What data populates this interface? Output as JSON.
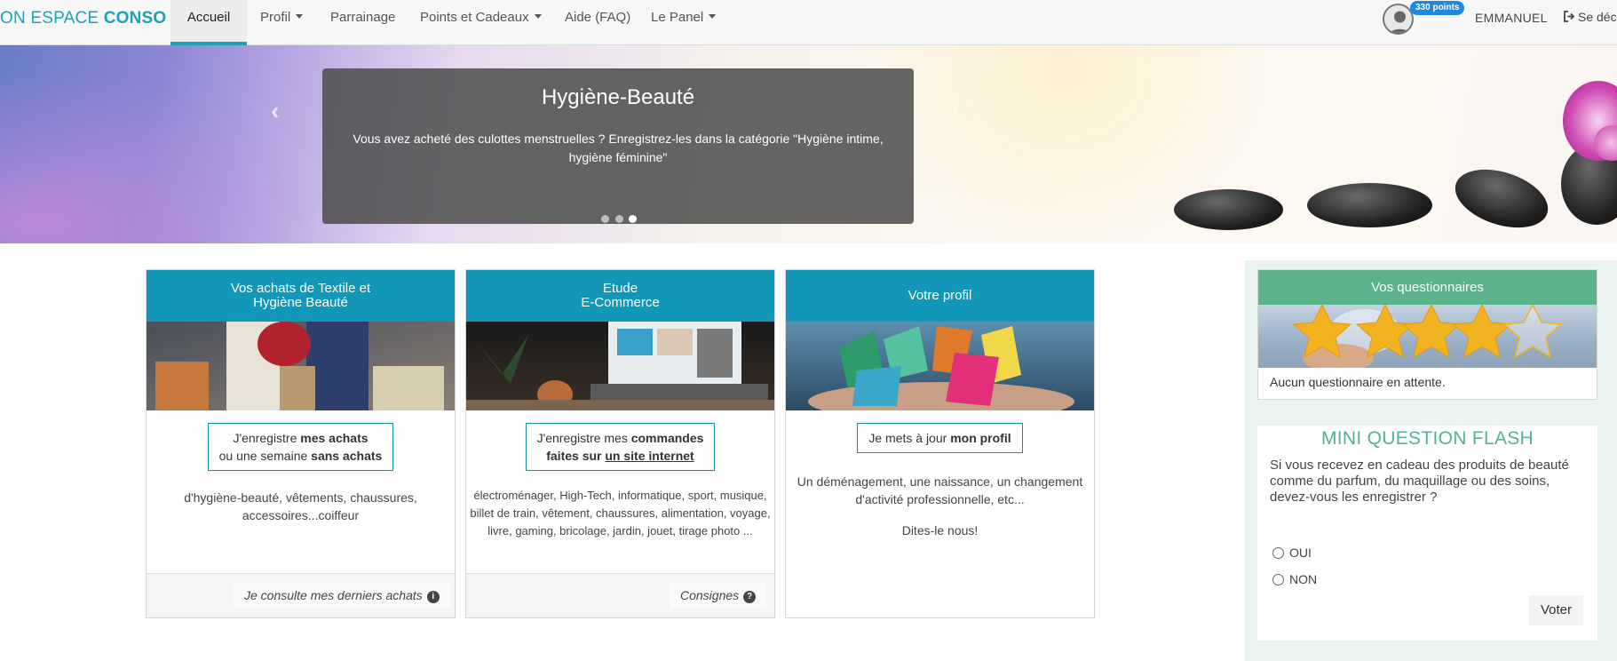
{
  "navbar": {
    "brand_prefix": "ON ESPACE ",
    "brand_bold": "CONSO",
    "items": [
      {
        "label": "Accueil"
      },
      {
        "label": "Profil"
      },
      {
        "label": "Parrainage"
      },
      {
        "label": "Points et Cadeaux"
      },
      {
        "label": "Aide (FAQ)"
      },
      {
        "label": "Le Panel"
      }
    ],
    "points_badge": "330 points",
    "username": "EMMANUEL",
    "logout_label": "Se déc",
    "icons": {
      "avatar": "user-avatar-icon",
      "logout": "sign-out-icon"
    }
  },
  "hero": {
    "title": "Hygiène-Beauté",
    "text": "Vous avez acheté des culottes menstruelles ? Enregistrez-les dans la catégorie \"Hygiène intime, hygiène féminine\"",
    "slide_count": 3,
    "active_slide": 3,
    "icons": {
      "prev": "chevron-left-icon",
      "next": "chevron-right-icon"
    }
  },
  "cards": [
    {
      "title_line1": "Vos achats de Textile et",
      "title_line2": "Hygiène Beauté",
      "cta_line1_pre": "J'enregistre ",
      "cta_line1_bold": "mes achats",
      "cta_line2_pre": "ou une semaine ",
      "cta_line2_bold": "sans achats",
      "desc": "d'hygiène-beauté, vêtements, chaussures, accessoires...coiffeur",
      "footer_link": "Je consulte mes derniers achats",
      "footer_icon": "info-circle-icon"
    },
    {
      "title_line1": "Etude",
      "title_line2": "E-Commerce",
      "cta_line1_pre": "J'enregistre mes ",
      "cta_line1_bold": "commandes",
      "cta_line2_pre": "faites sur ",
      "cta_line2_bold": "un site internet",
      "desc": "électroménager, High-Tech, informatique, sport, musique, billet de train, vêtement, chaussures, alimentation, voyage, livre, gaming, bricolage, jardin, jouet, tirage photo ...",
      "footer_link": "Consignes",
      "footer_icon": "question-circle-icon"
    },
    {
      "title": "Votre profil",
      "cta_pre": "Je mets à jour ",
      "cta_bold": "mon profil",
      "desc": "Un déménagement, une naissance, un changement d'activité professionnelle, etc...",
      "desc2": "Dites-le nous!"
    }
  ],
  "questionnaires": {
    "title": "Vos questionnaires",
    "empty_text": "Aucun questionnaire en attente.",
    "stars_filled": 4,
    "stars_total": 5
  },
  "flash": {
    "title": "MINI QUESTION FLASH",
    "question": "Si vous recevez en cadeau des produits de beauté comme du parfum, du maquillage ou des soins, devez-vous les enregistrer ?",
    "options": [
      "OUI",
      "NON"
    ],
    "vote_label": "Voter"
  },
  "colors": {
    "brand": "#1aa3b5",
    "card_header": "#1297b8",
    "questionnaire_header": "#5cb38a",
    "flash_title": "#55b38c",
    "badge": "#1e88e5"
  }
}
